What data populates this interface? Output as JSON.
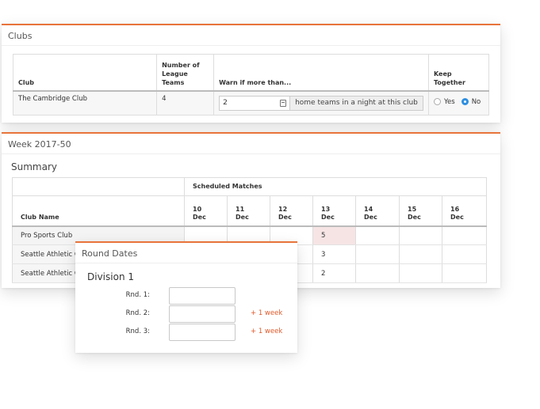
{
  "clubs_panel": {
    "title": "Clubs",
    "headers": {
      "club": "Club",
      "num_teams_line1": "Number of",
      "num_teams_line2": "League",
      "num_teams_line3": "Teams",
      "warn": "Warn if more than...",
      "keep_together": "Keep Together"
    },
    "row": {
      "club": "The Cambridge Club",
      "num_teams": "4",
      "warn_value": "2",
      "warn_suffix": "home teams in a night at this club",
      "yes_label": "Yes",
      "no_label": "No",
      "keep_together_selected": "No"
    }
  },
  "week_panel": {
    "title": "Week 2017-50",
    "summary_title": "Summary",
    "group_header": "Scheduled Matches",
    "club_name_header": "Club Name",
    "dates": [
      {
        "day": "10",
        "month": "Dec"
      },
      {
        "day": "11",
        "month": "Dec"
      },
      {
        "day": "12",
        "month": "Dec"
      },
      {
        "day": "13",
        "month": "Dec"
      },
      {
        "day": "14",
        "month": "Dec"
      },
      {
        "day": "15",
        "month": "Dec"
      },
      {
        "day": "16",
        "month": "Dec"
      }
    ],
    "rows": [
      {
        "club": "Pro Sports Club",
        "dec13": "5"
      },
      {
        "club": "Seattle Athletic Cl",
        "dec13": "3"
      },
      {
        "club": "Seattle Athletic Cl",
        "dec13": "2"
      }
    ]
  },
  "rounds_panel": {
    "title": "Round Dates",
    "division": "Division 1",
    "rounds": [
      {
        "label": "Rnd. 1:",
        "increment": ""
      },
      {
        "label": "Rnd. 2:",
        "increment": "+ 1 week"
      },
      {
        "label": "Rnd. 3:",
        "increment": "+ 1 week"
      }
    ]
  },
  "colors": {
    "accent": "#e8743b",
    "radio_selected": "#2d8fe0",
    "highlight_cell": "#f6e4e4",
    "increment_text": "#e05a2b"
  },
  "icons": {
    "warn_input_addon": "calendar-icon"
  }
}
